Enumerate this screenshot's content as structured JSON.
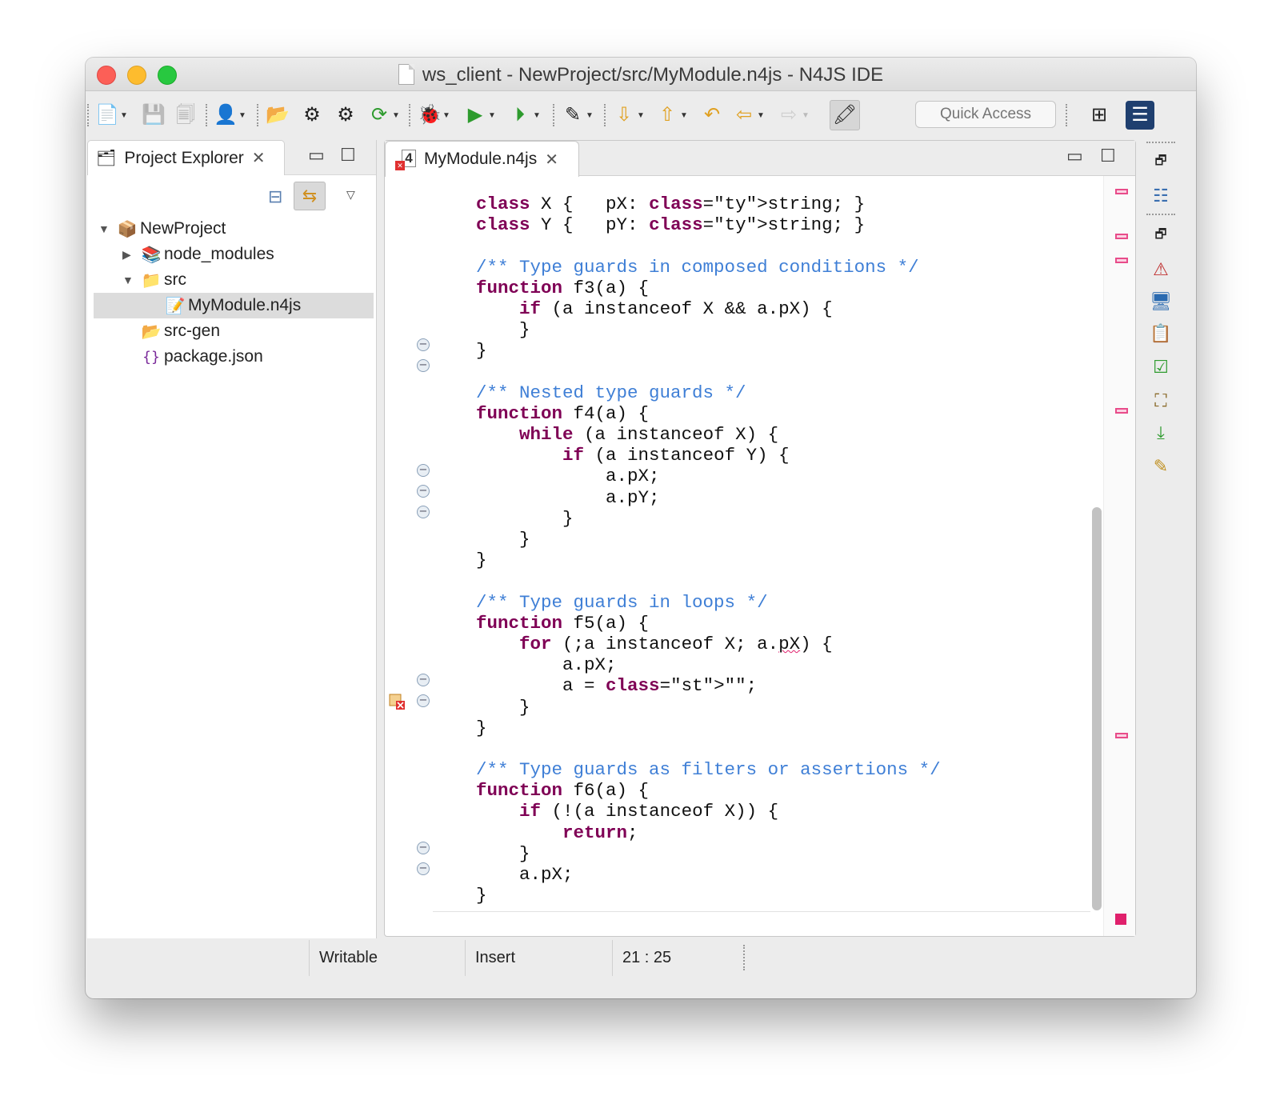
{
  "window": {
    "title": "ws_client - NewProject/src/MyModule.n4js - N4JS IDE"
  },
  "toolbar": {
    "quick_access_placeholder": "Quick Access"
  },
  "explorer": {
    "tab_label": "Project Explorer",
    "tree": [
      {
        "label": "NewProject",
        "level": 0,
        "expanded": true
      },
      {
        "label": "node_modules",
        "level": 1,
        "expanded": false
      },
      {
        "label": "src",
        "level": 1,
        "expanded": true
      },
      {
        "label": "MyModule.n4js",
        "level": 2,
        "selected": true
      },
      {
        "label": "src-gen",
        "level": 1
      },
      {
        "label": "package.json",
        "level": 1
      }
    ]
  },
  "editor": {
    "tab_label": "MyModule.n4js",
    "code_lines": [
      "    class X {   pX: string; }",
      "    class Y {   pY: string; }",
      "",
      "    /** Type guards in composed conditions */",
      "    function f3(a) {",
      "        if (a instanceof X && a.pX) {",
      "        }",
      "    }",
      "",
      "    /** Nested type guards */",
      "    function f4(a) {",
      "        while (a instanceof X) {",
      "            if (a instanceof Y) {",
      "                a.pX;",
      "                a.pY;",
      "            }",
      "        }",
      "    }",
      "",
      "    /** Type guards in loops */",
      "    function f5(a) {",
      "        for (;a instanceof X; a.pX) {",
      "            a.pX;",
      "            a = \"\";",
      "        }",
      "    }",
      "",
      "    /** Type guards as filters or assertions */",
      "    function f6(a) {",
      "        if (!(a instanceof X)) {",
      "            return;",
      "        }",
      "        a.pX;",
      "    }"
    ]
  },
  "status": {
    "writable": "Writable",
    "insert_mode": "Insert",
    "cursor_position": "21 : 25"
  },
  "colors": {
    "keyword": "#7f0055",
    "comment": "#3f7fd6",
    "string": "#2a00ff",
    "error_mark": "#e0206c"
  }
}
